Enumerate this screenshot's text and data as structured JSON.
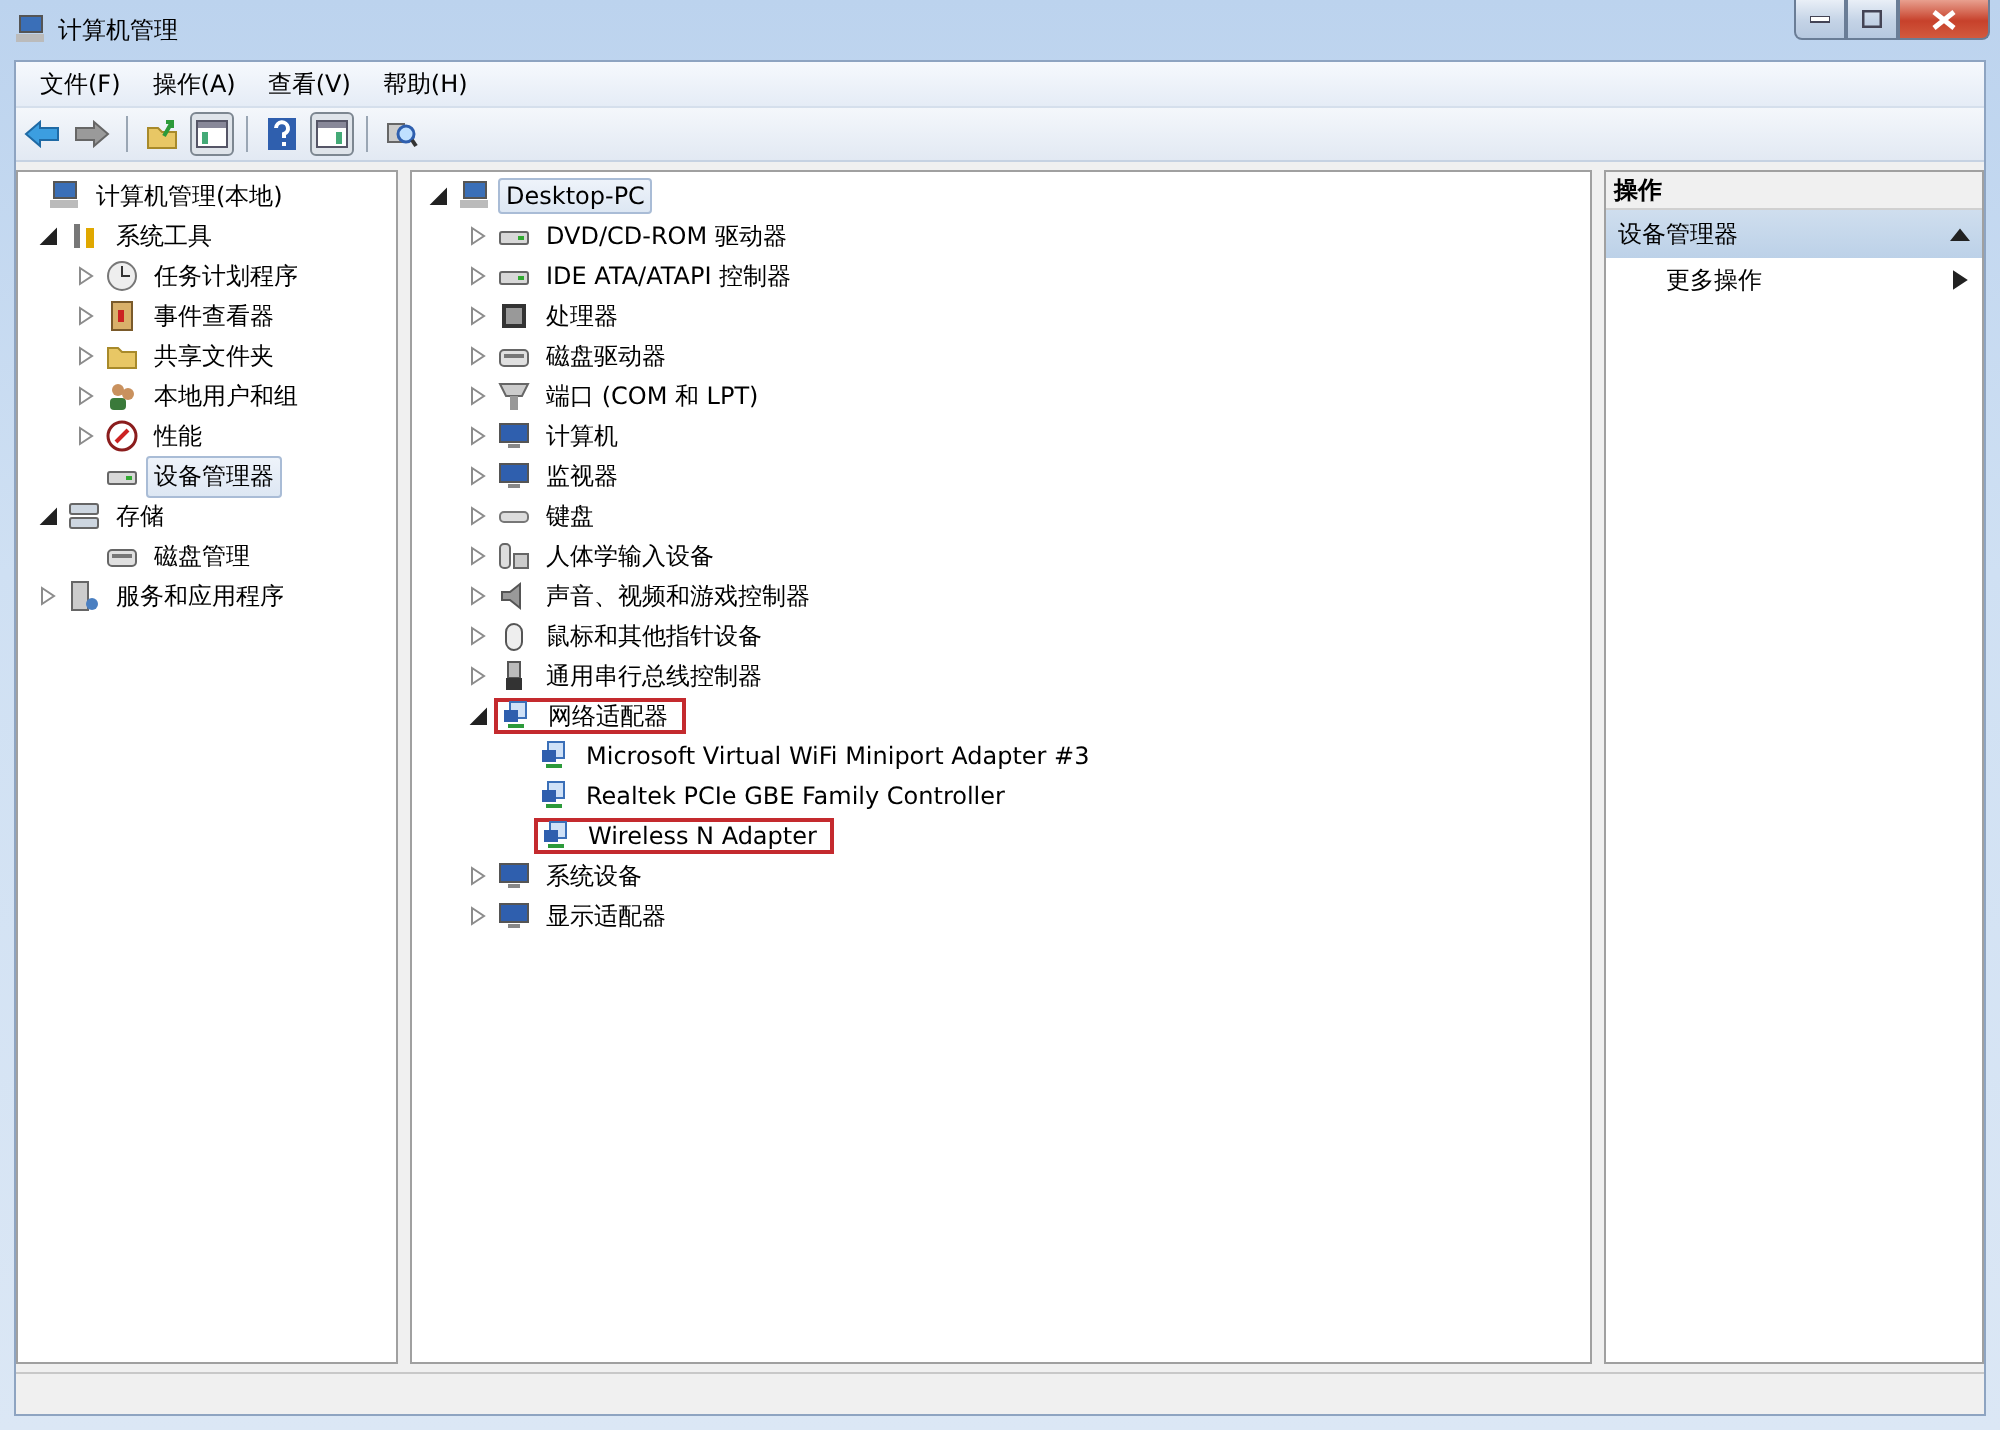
{
  "window": {
    "title": "计算机管理"
  },
  "menu": [
    "文件(F)",
    "操作(A)",
    "查看(V)",
    "帮助(H)"
  ],
  "left_tree": [
    {
      "label": "计算机管理(本地)",
      "selected": false,
      "children": [
        {
          "label": "系统工具",
          "expanded": true,
          "selected": false,
          "children": [
            {
              "label": "任务计划程序",
              "expanded": false,
              "selected": false
            },
            {
              "label": "事件查看器",
              "expanded": false,
              "selected": false
            },
            {
              "label": "共享文件夹",
              "expanded": false,
              "selected": false
            },
            {
              "label": "本地用户和组",
              "expanded": false,
              "selected": false
            },
            {
              "label": "性能",
              "expanded": false,
              "selected": false
            },
            {
              "label": "设备管理器",
              "selected": true
            }
          ]
        },
        {
          "label": "存储",
          "expanded": true,
          "selected": false,
          "children": [
            {
              "label": "磁盘管理",
              "selected": false
            }
          ]
        },
        {
          "label": "服务和应用程序",
          "expanded": false,
          "selected": false
        }
      ]
    }
  ],
  "device_tree": [
    {
      "label": "Desktop-PC",
      "expanded": true,
      "selected": true,
      "highlighted": false,
      "children": [
        {
          "label": "DVD/CD-ROM 驱动器",
          "expanded": false,
          "selected": false,
          "highlighted": false
        },
        {
          "label": "IDE ATA/ATAPI 控制器",
          "expanded": false,
          "selected": false,
          "highlighted": false
        },
        {
          "label": "处理器",
          "expanded": false,
          "selected": false,
          "highlighted": false
        },
        {
          "label": "磁盘驱动器",
          "expanded": false,
          "selected": false,
          "highlighted": false
        },
        {
          "label": "端口 (COM 和 LPT)",
          "expanded": false,
          "selected": false,
          "highlighted": false
        },
        {
          "label": "计算机",
          "expanded": false,
          "selected": false,
          "highlighted": false
        },
        {
          "label": "监视器",
          "expanded": false,
          "selected": false,
          "highlighted": false
        },
        {
          "label": "键盘",
          "expanded": false,
          "selected": false,
          "highlighted": false
        },
        {
          "label": "人体学输入设备",
          "expanded": false,
          "selected": false,
          "highlighted": false
        },
        {
          "label": "声音、视频和游戏控制器",
          "expanded": false,
          "selected": false,
          "highlighted": false
        },
        {
          "label": "鼠标和其他指针设备",
          "expanded": false,
          "selected": false,
          "highlighted": false
        },
        {
          "label": "通用串行总线控制器",
          "expanded": false,
          "selected": false,
          "highlighted": false
        },
        {
          "label": "网络适配器",
          "expanded": true,
          "selected": false,
          "highlighted": true,
          "children": [
            {
              "label": "Microsoft Virtual WiFi Miniport Adapter #3",
              "selected": false,
              "highlighted": false
            },
            {
              "label": "Realtek PCIe GBE Family Controller",
              "selected": false,
              "highlighted": false
            },
            {
              "label": "Wireless N Adapter",
              "selected": false,
              "highlighted": true
            }
          ]
        },
        {
          "label": "系统设备",
          "expanded": false,
          "selected": false,
          "highlighted": false
        },
        {
          "label": "显示适配器",
          "expanded": false,
          "selected": false,
          "highlighted": false
        }
      ]
    }
  ],
  "actions": {
    "header": "操作",
    "section": {
      "label": "设备管理器",
      "expanded": true
    },
    "items": [
      {
        "label": "更多操作"
      }
    ]
  }
}
